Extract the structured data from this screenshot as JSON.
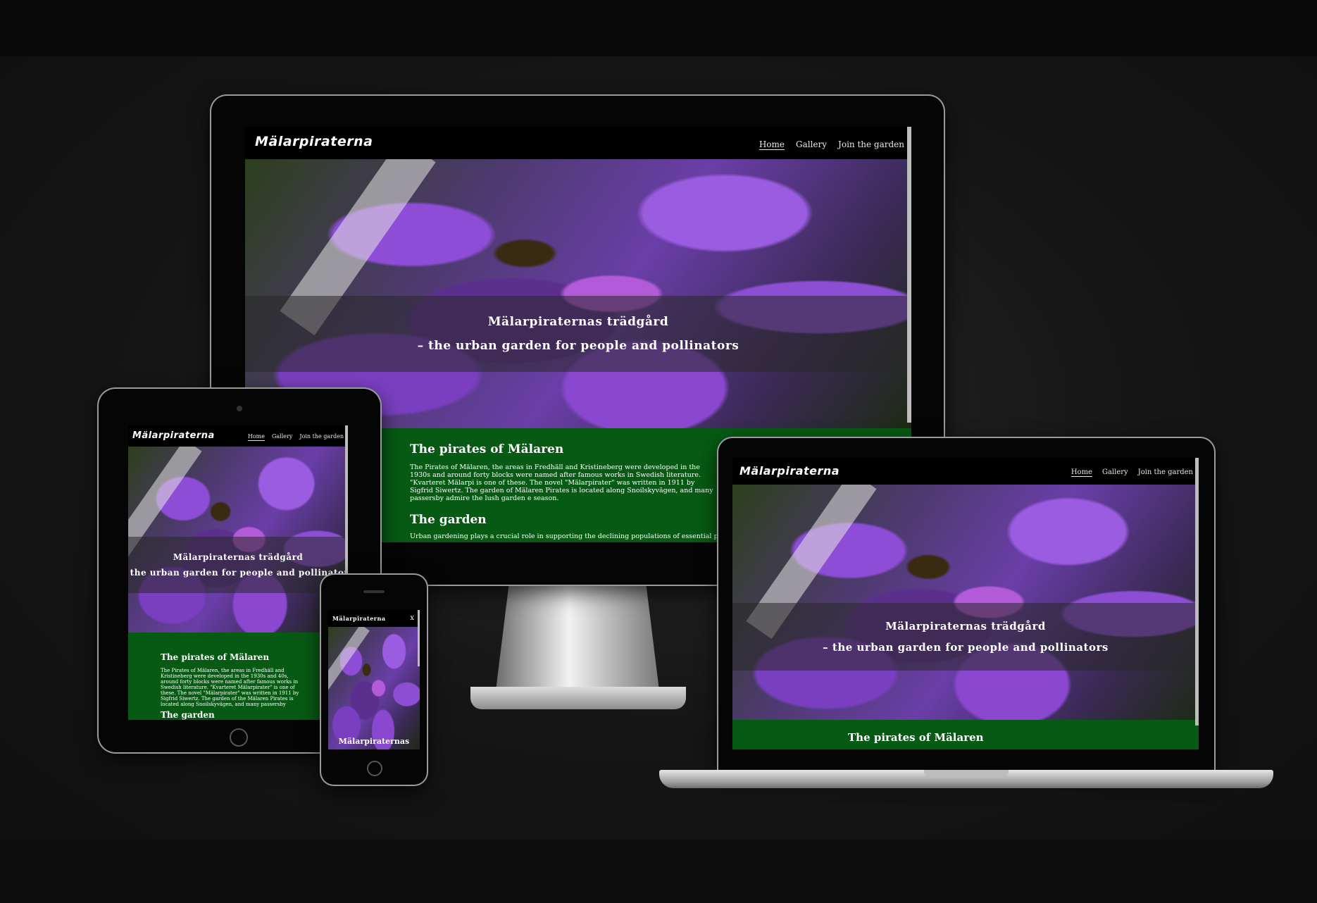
{
  "site": {
    "logo": "Mälarpiraterna",
    "nav": {
      "home": "Home",
      "gallery": "Gallery",
      "join": "Join the garden"
    },
    "hero": {
      "line1": "Mälarpiraternas trädgård",
      "line2": "– the urban garden for people and pollinators"
    },
    "section1": {
      "title": "The pirates of Mälaren",
      "text_desktop": "The Pirates of Mälaren, the areas in Fredhäll and Kristineberg were developed in the 1930s and around forty blocks were named after famous works in Swedish literature. \"Kvarteret Mälarpi is one of these. The novel \"Mälarpirater\" was written in 1911 by Sigfrid Siwertz. The garden of Mälaren Pirates is located along Snoilskyvägen, and many passersby admire the lush garden e season.",
      "text_tablet": "The Pirates of Mälaren, the areas in Fredhäll and Kristineberg were developed in the 1930s and 40s, around forty blocks were named after famous works in Swedish literature. \"Kvarteret Mälarpirater\" is one of these. The novel \"Mälarpirater\" was written in 1911 by Sigfrid Siwertz. The garden of the Mälaren Pirates is located along Snoilskyvägen, and many passersby admire the lush garden each season."
    },
    "section2": {
      "title": "The garden",
      "text_desktop": "Urban gardening plays a crucial role in supporting the declining populations of essential polli"
    },
    "mobile": {
      "close": "x",
      "hero_partial": "Mälarpiraternas"
    }
  },
  "colors": {
    "content_green": "#075a14",
    "background": "#121212",
    "nav": "#000000"
  }
}
